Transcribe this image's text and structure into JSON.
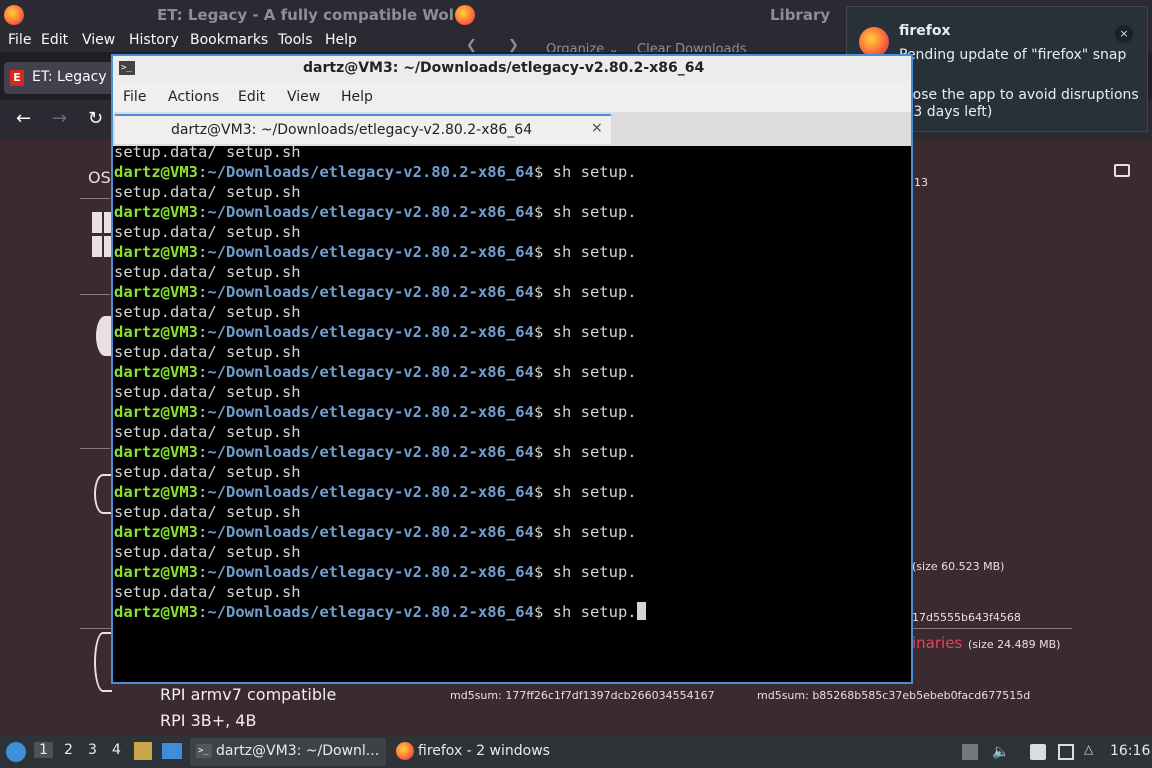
{
  "firefox": {
    "window_title": "ET: Legacy - A fully compatible Wol",
    "library_title": "Library",
    "menu": [
      "File",
      "Edit",
      "View",
      "History",
      "Bookmarks",
      "Tools",
      "Help"
    ],
    "tab_label": "ET: Legacy -",
    "library_toolbar": {
      "organize": "Organize ⌄",
      "clear_downloads": "Clear Downloads"
    }
  },
  "webpage": {
    "os_label": "OS",
    "number_fragment": "13",
    "size_1": "(size 60.523 MB)",
    "md5_fragment": "17d5555b643f4568",
    "binaries_link": "inaries",
    "size_2": "(size 24.489 MB)",
    "rpi_line1": "RPI armv7 compatible",
    "rpi_line2": "RPI 3B+, 4B",
    "md5_a": "md5sum: 177ff26c1f7df1397dcb266034554167",
    "md5_b": "md5sum: b85268b585c37eb5ebeb0facd677515d"
  },
  "notification": {
    "app": "firefox",
    "body": "Pending update of \"firefox\" snap",
    "body2": "Close the app to avoid disruptions (13 days left)",
    "close": "×"
  },
  "terminal": {
    "title": "dartz@VM3: ~/Downloads/etlegacy-v2.80.2-x86_64",
    "menu": [
      "File",
      "Actions",
      "Edit",
      "View",
      "Help"
    ],
    "tab_label": "dartz@VM3: ~/Downloads/etlegacy-v2.80.2-x86_64",
    "tab_close": "⨯",
    "user_host": "dartz@VM3",
    "path": "~/Downloads/etlegacy-v2.80.2-x86_64",
    "command": "sh setup.",
    "listing": "setup.data/ setup.sh"
  },
  "taskbar": {
    "workspaces": [
      "1",
      "2",
      "3",
      "4"
    ],
    "terminal_task": "dartz@VM3: ~/Downl...",
    "firefox_task": "firefox - 2 windows",
    "clock": "16:16"
  }
}
